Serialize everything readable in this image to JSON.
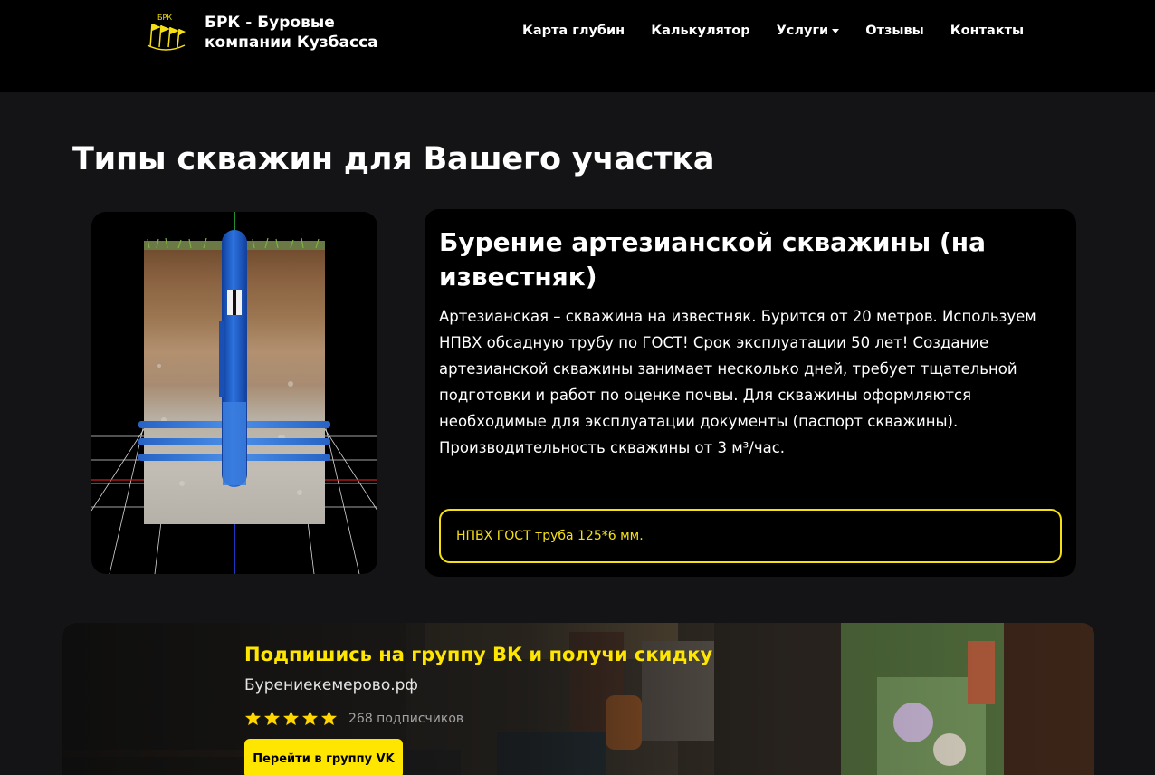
{
  "brand": {
    "name": "БРК - Буровые компании Кузбасса",
    "logo_text": "БРК",
    "logo_icon": "flags-logo-icon"
  },
  "nav": {
    "items": [
      {
        "label": "Карта глубин"
      },
      {
        "label": "Калькулятор"
      },
      {
        "label": "Услуги",
        "has_dropdown": true
      },
      {
        "label": "Отзывы"
      },
      {
        "label": "Контакты"
      }
    ]
  },
  "section": {
    "title": "Типы скважин для Вашего участка"
  },
  "well_card": {
    "title": "Бурение артезианской скважины (на известняк)",
    "description": "Артезианская – скважина на известняк. Бурится от 20 метров. Используем НПВХ обсадную трубу по ГОСТ! Срок эксплуатации 50 лет! Создание артезианской скважины занимает несколько дней, требует тщательной подготовки и работ по оценке почвы. Для скважины оформляются необходимые для эксплуатации документы (паспорт скважины). Производительность скважины от 3 м³/час.",
    "spec": "НПВХ ГОСТ труба 125*6 мм."
  },
  "vk": {
    "title": "Подпишись на группу ВК и получи скидку",
    "domain": "Бурениекемерово.рф",
    "rating_stars": 5,
    "subscribers": "268 подписчиков",
    "button_label": "Перейти в группу VK"
  },
  "colors": {
    "accent": "#ffe600",
    "navbar_bg": "#000000",
    "page_bg": "#141416",
    "card_bg": "#000000",
    "pipe_blue": "#1f5fd0"
  }
}
